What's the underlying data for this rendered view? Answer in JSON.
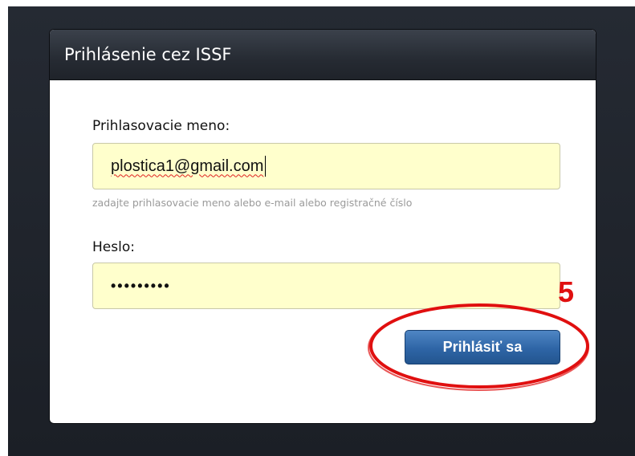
{
  "panel": {
    "title": "Prihlásenie cez ISSF"
  },
  "username": {
    "label": "Prihlasovacie meno:",
    "value": "plostica1@gmail.com",
    "hint": "zadajte prihlasovacie meno alebo e-mail alebo registračné číslo"
  },
  "password": {
    "label": "Heslo:",
    "masked_value": "•••••••••"
  },
  "login_button": {
    "label": "Prihlásiť sa"
  },
  "annotation": {
    "step_number": "5",
    "color": "#e01010"
  },
  "colors": {
    "field_background": "#ffffcc",
    "button_blue": "#2e65a6",
    "header_dark": "#262b33"
  }
}
